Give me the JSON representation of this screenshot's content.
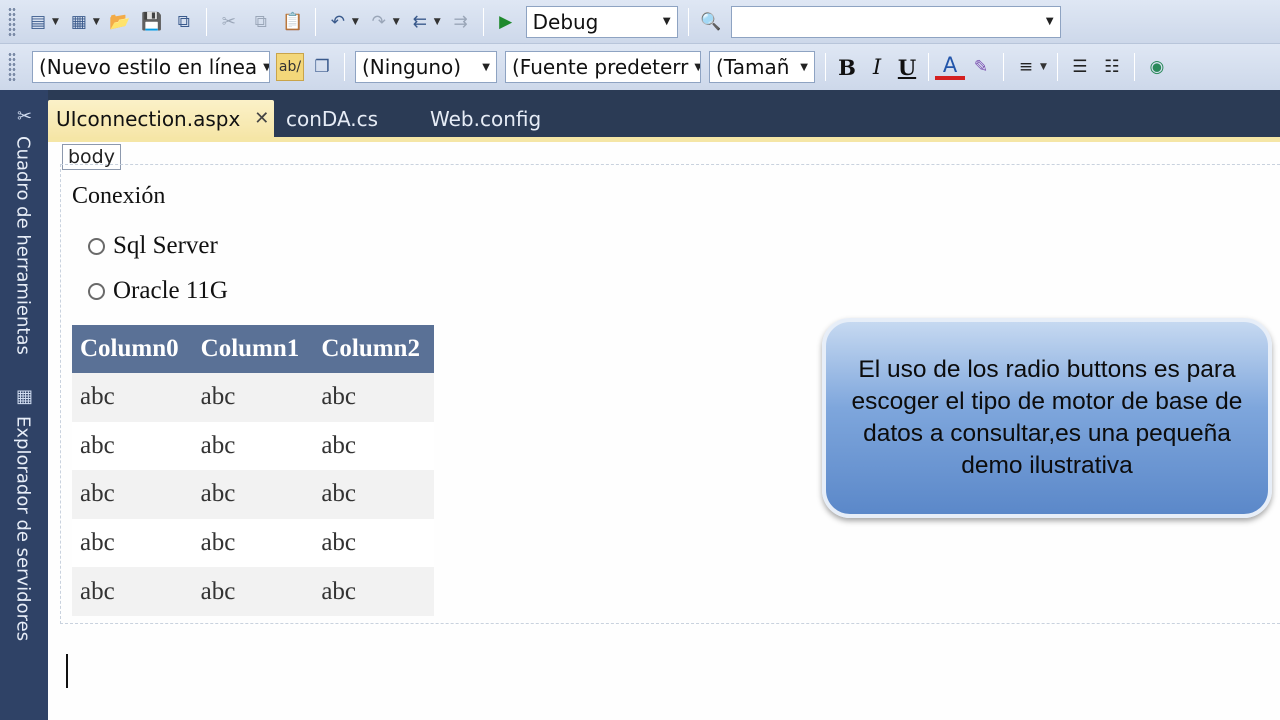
{
  "toolbar1": {
    "config_combo": "Debug",
    "search_combo": ""
  },
  "toolbar2": {
    "style_combo": "(Nuevo estilo en línea",
    "block_combo": "(Ninguno)",
    "font_combo": "(Fuente predeterr",
    "size_combo": "(Tamañ",
    "bold_label": "B",
    "italic_label": "I",
    "underline_label": "U"
  },
  "side_panel": {
    "toolbox_label": "Cuadro de herramientas",
    "server_explorer_label": "Explorador de servidores"
  },
  "tabs": [
    {
      "label": "UIconnection.aspx",
      "active": true
    },
    {
      "label": "conDA.cs",
      "active": false
    },
    {
      "label": "Web.config",
      "active": false
    }
  ],
  "designer": {
    "body_tag": "body",
    "heading": "Conexión",
    "radios": [
      {
        "label": "Sql Server"
      },
      {
        "label": "Oracle 11G"
      }
    ],
    "grid": {
      "headers": [
        "Column0",
        "Column1",
        "Column2"
      ],
      "rows": [
        [
          "abc",
          "abc",
          "abc"
        ],
        [
          "abc",
          "abc",
          "abc"
        ],
        [
          "abc",
          "abc",
          "abc"
        ],
        [
          "abc",
          "abc",
          "abc"
        ],
        [
          "abc",
          "abc",
          "abc"
        ]
      ]
    }
  },
  "callout": {
    "text": "El uso de los radio buttons es para escoger el tipo de motor de base de datos a consultar,es una pequeña demo ilustrativa"
  },
  "colors": {
    "grid_header": "#5a7196",
    "active_tab": "#f6e6a8",
    "callout": "#5b88c9"
  }
}
